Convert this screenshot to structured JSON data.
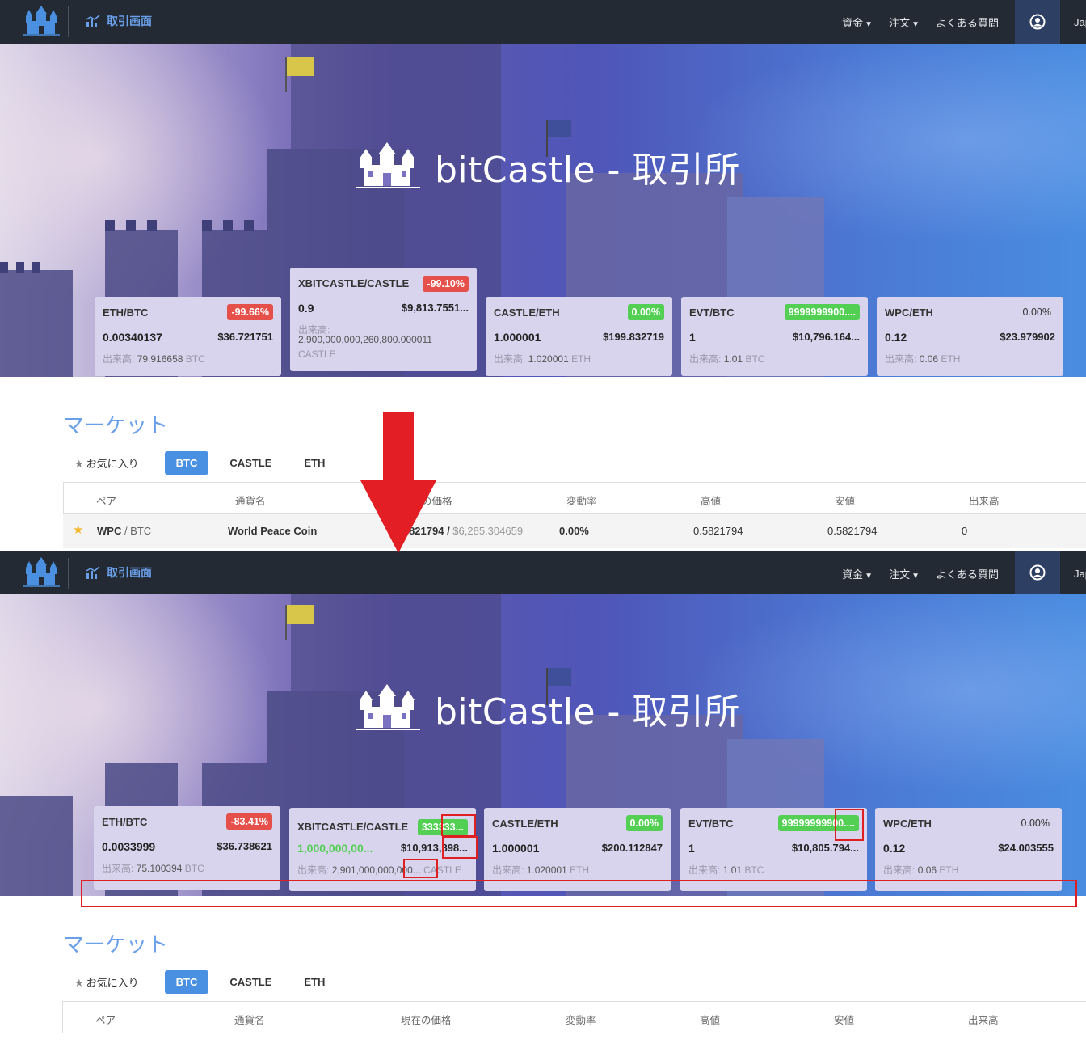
{
  "nav": {
    "trade_label": "取引画面",
    "menu": [
      {
        "label": "資金",
        "caret": "▼"
      },
      {
        "label": "注文",
        "caret": "▼"
      },
      {
        "label": "よくある質問",
        "caret": ""
      }
    ],
    "lang": "Jap"
  },
  "hero": {
    "title": "bitCastle - 取引所"
  },
  "before": {
    "tickers": [
      {
        "pair": "ETH/BTC",
        "change": "-99.66%",
        "change_color": "red",
        "price": "0.00340137",
        "usd": "$36.721751",
        "vol_label": "出来高:",
        "vol": "79.916658",
        "vol_unit": "BTC"
      },
      {
        "pair": "XBITCASTLE/CASTLE",
        "change": "-99.10%",
        "change_color": "red",
        "price": "0.9",
        "usd": "$9,813.7551...",
        "vol_label": "出来高:",
        "vol": "2,900,000,000,260,800.000011",
        "vol_unit": "CASTLE"
      },
      {
        "pair": "CASTLE/ETH",
        "change": "0.00%",
        "change_color": "green",
        "price": "1.000001",
        "usd": "$199.832719",
        "vol_label": "出来高:",
        "vol": "1.020001",
        "vol_unit": "ETH"
      },
      {
        "pair": "EVT/BTC",
        "change": "9999999900....",
        "change_color": "green",
        "price": "1",
        "usd": "$10,796.164...",
        "vol_label": "出来高:",
        "vol": "1.01",
        "vol_unit": "BTC"
      },
      {
        "pair": "WPC/ETH",
        "change": "0.00%",
        "change_color": "none",
        "price": "0.12",
        "usd": "$23.979902",
        "vol_label": "出来高:",
        "vol": "0.06",
        "vol_unit": "ETH"
      }
    ]
  },
  "after": {
    "tickers": [
      {
        "pair": "ETH/BTC",
        "change": "-83.41%",
        "change_color": "red",
        "price": "0.0033999",
        "usd": "$36.738621",
        "vol_label": "出来高:",
        "vol": "75.100394",
        "vol_unit": "BTC"
      },
      {
        "pair": "XBITCASTLE/CASTLE",
        "change": "333333...",
        "change_color": "green",
        "price": "1,000,000,00...",
        "usd": "$10,913,898...",
        "vol_label": "出来高:",
        "vol": "2,901,000,000,000...",
        "vol_unit": "CASTLE"
      },
      {
        "pair": "CASTLE/ETH",
        "change": "0.00%",
        "change_color": "green",
        "price": "1.000001",
        "usd": "$200.112847",
        "vol_label": "出来高:",
        "vol": "1.020001",
        "vol_unit": "ETH"
      },
      {
        "pair": "EVT/BTC",
        "change": "99999999900....",
        "change_color": "green",
        "price": "1",
        "usd": "$10,805.794...",
        "vol_label": "出来高:",
        "vol": "1.01",
        "vol_unit": "BTC"
      },
      {
        "pair": "WPC/ETH",
        "change": "0.00%",
        "change_color": "none",
        "price": "0.12",
        "usd": "$24.003555",
        "vol_label": "出来高:",
        "vol": "0.06",
        "vol_unit": "ETH"
      }
    ]
  },
  "market": {
    "title": "マーケット",
    "favorites": "お気に入り",
    "tabs": [
      "BTC",
      "CASTLE",
      "ETH"
    ],
    "columns": [
      "ペア",
      "通貨名",
      "現在の価格",
      "変動率",
      "高値",
      "安値",
      "出来高"
    ],
    "row": {
      "pair": "WPC",
      "quote": " / BTC",
      "name": "World Peace Coin",
      "price": "0.5821794",
      "price_sep": " / ",
      "price_usd": "$6,285.304659",
      "change": "0.00%",
      "high": "0.5821794",
      "low": "0.5821794",
      "volume": "0"
    }
  },
  "colors": {
    "accent": "#4a90e2",
    "nav_bg": "#232a33",
    "red_badge": "#e5504a",
    "green_badge": "#53cf54",
    "annotation": "#e02020"
  }
}
